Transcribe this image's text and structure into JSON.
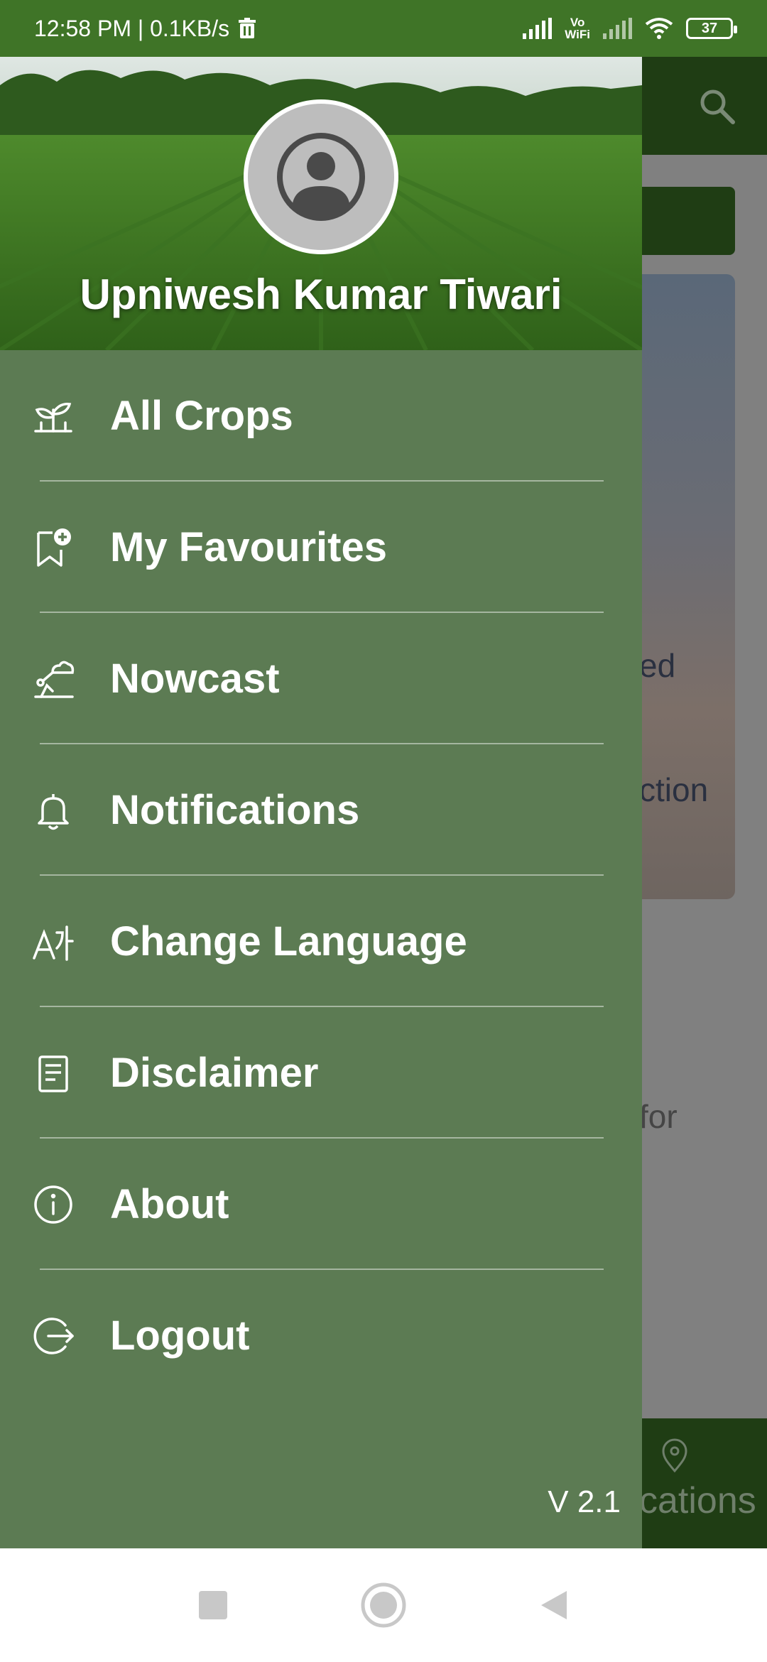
{
  "status_bar": {
    "time_speed": "12:58 PM | 0.1KB/s",
    "vowifi_line1": "Vo",
    "vowifi_line2": "WiFi",
    "battery": "37"
  },
  "background": {
    "partial_text_1": "ed",
    "partial_text_2": "ction",
    "partial_text_3": "for",
    "partial_text_4": "cations"
  },
  "drawer": {
    "user_name": "Upniwesh Kumar Tiwari",
    "menu": [
      {
        "label": "All Crops",
        "icon": "seedling-icon"
      },
      {
        "label": "My Favourites",
        "icon": "bookmark-add-icon"
      },
      {
        "label": "Nowcast",
        "icon": "weather-cloud-icon"
      },
      {
        "label": "Notifications",
        "icon": "bell-icon"
      },
      {
        "label": "Change Language",
        "icon": "translate-icon"
      },
      {
        "label": "Disclaimer",
        "icon": "document-icon"
      },
      {
        "label": "About",
        "icon": "info-icon"
      },
      {
        "label": "Logout",
        "icon": "logout-icon"
      }
    ],
    "version": "V 2.1"
  },
  "colors": {
    "status_bar": "#3f7427",
    "drawer": "#5c7b53",
    "app_dark_green": "#1f3d14"
  }
}
